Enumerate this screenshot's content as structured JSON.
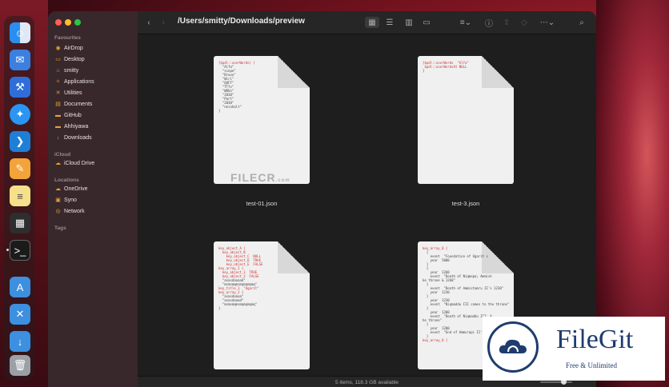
{
  "window": {
    "path": "/Users/smitty/Downloads/preview"
  },
  "sidebar": {
    "favourites_label": "Favourites",
    "favourites": [
      {
        "label": "AirDrop",
        "icon": "airdrop-icon"
      },
      {
        "label": "Desktop",
        "icon": "desktop-icon"
      },
      {
        "label": "smitty",
        "icon": "home-icon"
      },
      {
        "label": "Applications",
        "icon": "applications-icon"
      },
      {
        "label": "Utilities",
        "icon": "utilities-icon"
      },
      {
        "label": "Documents",
        "icon": "document-icon"
      },
      {
        "label": "GitHub",
        "icon": "folder-icon"
      },
      {
        "label": "Ahhiyawa",
        "icon": "folder-icon"
      },
      {
        "label": "Downloads",
        "icon": "downloads-icon"
      }
    ],
    "icloud_label": "iCloud",
    "icloud": [
      {
        "label": "iCloud Drive",
        "icon": "cloud-icon"
      }
    ],
    "locations_label": "Locations",
    "locations": [
      {
        "label": "OneDrive",
        "icon": "cloud-icon"
      },
      {
        "label": "Syno",
        "icon": "server-icon"
      },
      {
        "label": "Network",
        "icon": "network-icon"
      }
    ],
    "tags_label": "Tags"
  },
  "files": [
    {
      "name": "test-01.json",
      "preview": [
        "{$pdl::userWords) {",
        "  \"Alfa\"",
        "  \"scope\"",
        "  \"Bravo\"",
        "  \"Wiri\"",
        "  \"QUFF\"",
        "  \"TTfs\"",
        "  \"WRUs\"",
        "  \"2030\"",
        "  \"Part\"",
        "  \"2030\"",
        "  \"neinhalt\"",
        "}"
      ]
    },
    {
      "name": "test-3.json",
      "preview": [
        "{$pdl::userWords  \"Alfa\"",
        " $pdl::userWordsAt NULL",
        "}"
      ]
    },
    {
      "name": "",
      "preview": [
        "key_object_A {",
        "  key_object_B",
        "    key_object_C  NULL",
        "    key_object_D  TRUE",
        "    key_object_E  FALSE",
        "",
        "",
        "key_array_1 {",
        "",
        "  key_object_1  TRUE",
        "",
        "",
        "  key_object_2  FALSE",
        "",
        "",
        "  \"asasdaaaad\"",
        "  \"msmsmqmsmqmqmqmq\"",
        "",
        "key_title_1  \"Ugarit\"",
        "key_array_2 {",
        "  \"asasdaaaa\"",
        "  \"asasdaaad\"",
        "  \"msmsmqmsmqmqmqmq\"",
        "}"
      ]
    },
    {
      "name": "",
      "preview": [
        "key_array_0 {",
        "  {",
        "    event  \"Foundation of Ugarit s",
        "    year  5000",
        "  }",
        "",
        "  {",
        "    year  1260",
        "    event  \"Death of Niqmepa; Ammish",
        "ke throne & 1260\"",
        "  }",
        "",
        "    event  \"Death of Ammistamru II's 1230\"",
        "    year  1230",
        "  }",
        "",
        "    year  1230",
        "    event  \"Niqmaddu III comes to the throne\"",
        "  }",
        "",
        "    year  1200",
        "    event  \"Death of Niqmaddu III; A",
        "he throne\"",
        "  }",
        "",
        "    year  1200",
        "    event  \"End of Ammurapi II's reig",
        "  }",
        "key_array_0 {"
      ]
    }
  ],
  "statusbar": {
    "text": "5 items, 118.3 GB available"
  },
  "watermark": {
    "text": "FILECR",
    "suffix": ".com"
  },
  "badge": {
    "name": "FileGit",
    "tagline": "Free & Unlimited"
  }
}
